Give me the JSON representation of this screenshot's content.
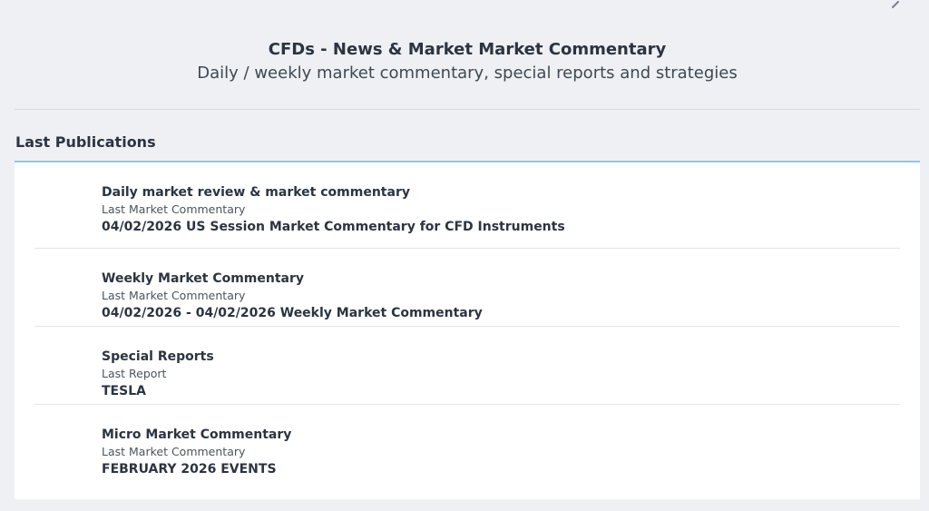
{
  "header": {
    "title": "CFDs - News & Market Market Commentary",
    "subtitle": "Daily / weekly market commentary, special reports and strategies"
  },
  "section": {
    "title": "Last Publications"
  },
  "publications": [
    {
      "name": "Daily market review & market commentary",
      "kind": "Last Market Commentary",
      "latest": "04/02/2026 US Session Market Commentary for CFD Instruments"
    },
    {
      "name": "Weekly Market Commentary",
      "kind": "Last Market Commentary",
      "latest": "04/02/2026 - 04/02/2026 Weekly Market Commentary"
    },
    {
      "name": "Special Reports",
      "kind": "Last Report",
      "latest": "TESLA"
    },
    {
      "name": "Micro Market Commentary",
      "kind": "Last Market Commentary",
      "latest": "FEBRUARY 2026 EVENTS"
    }
  ],
  "colors": {
    "accent": "#8ec7ea",
    "page_bg": "#eef0f3",
    "panel_bg": "#ffffff"
  },
  "icons": {
    "top_right": "search-icon"
  }
}
